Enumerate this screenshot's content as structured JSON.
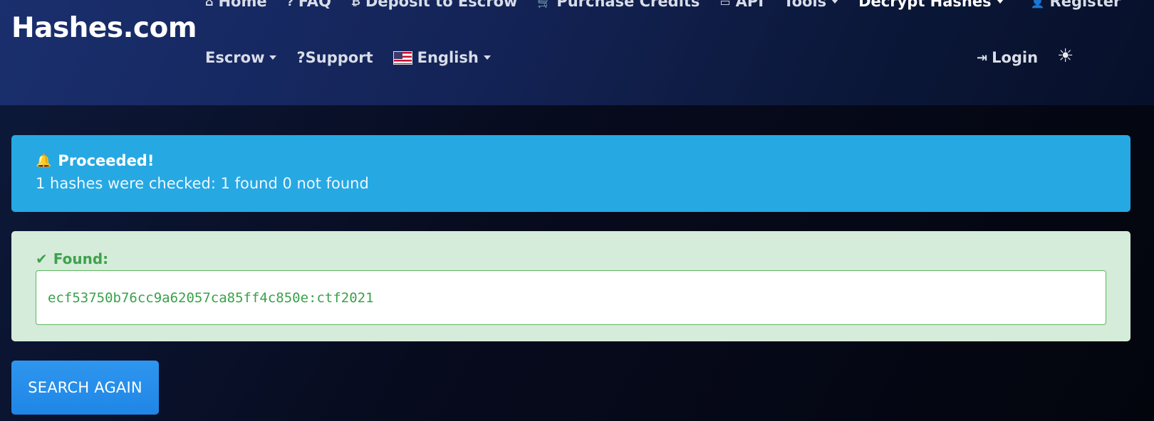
{
  "brand": "Hashes.com",
  "nav_top": [
    {
      "icon": "home-icon",
      "glyph": "⌂",
      "label": "Home"
    },
    {
      "icon": "question-icon",
      "glyph": "?",
      "label": "FAQ"
    },
    {
      "icon": "bitcoin-icon",
      "glyph": "₿",
      "label": "Deposit to Escrow"
    },
    {
      "icon": "cart-icon",
      "glyph": "🛒",
      "label": "Purchase Credits"
    },
    {
      "icon": "terminal-icon",
      "glyph": "▭",
      "label": "API"
    },
    {
      "label": "Tools"
    },
    {
      "label": "Decrypt Hashes"
    },
    {
      "icon": "user-plus-icon",
      "glyph": "👤",
      "label": "Register"
    }
  ],
  "nav_second": {
    "escrow": "Escrow",
    "support": "?Support",
    "language": "English"
  },
  "login": "Login",
  "theme_toggle_glyph": "☀",
  "alert": {
    "title": "Proceeded!",
    "message": "1 hashes were checked: 1 found 0 not found",
    "color": "#26a8e3"
  },
  "found": {
    "title": "Found:",
    "result": "ecf53750b76cc9a62057ca85ff4c850e:ctf2021",
    "color": "#3ea14c"
  },
  "button": {
    "search_again": "SEARCH AGAIN"
  }
}
